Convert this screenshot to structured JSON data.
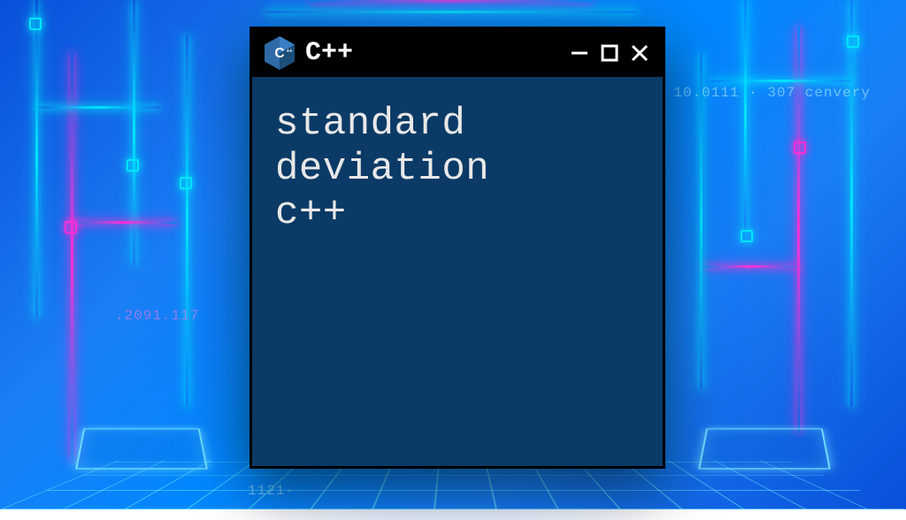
{
  "window": {
    "title": "C++",
    "icon": "cpp-hex-icon",
    "controls": {
      "minimize": "minimize",
      "maximize": "maximize",
      "close": "close"
    }
  },
  "content": {
    "lines": [
      "standard",
      "deviation",
      "c++"
    ]
  },
  "background": {
    "theme": "neon-circuit-cyberpunk",
    "accent_cyan": "#00e5ff",
    "accent_pink": "#ff2fd6",
    "deco_text": {
      "top_right": "10.0111 · 307  cenvery",
      "left_1": ".2091.117",
      "bottom_1": "1121·"
    }
  }
}
